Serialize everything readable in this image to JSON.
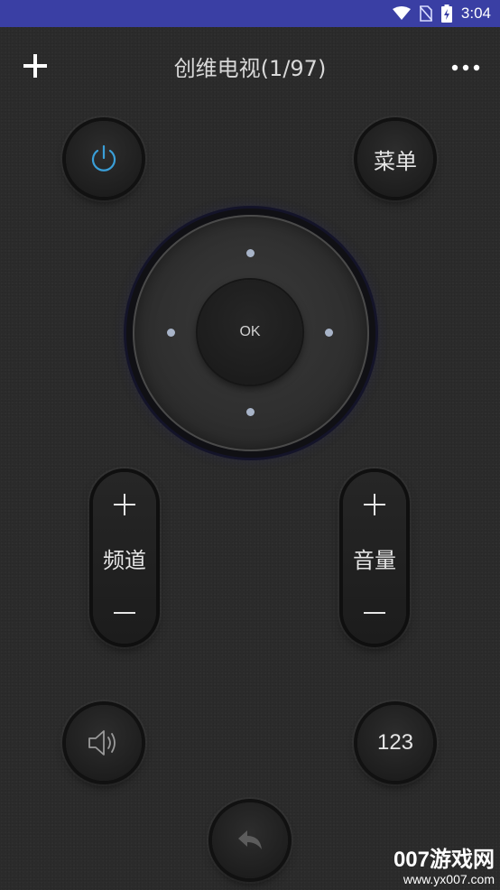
{
  "status_bar": {
    "time": "3:04",
    "bg_color": "#3a3fa4",
    "icons": [
      "wifi-icon",
      "no-sim-icon",
      "battery-charging-icon"
    ]
  },
  "top_bar": {
    "title": "创维电视(1/97)",
    "left_icon": "plus-icon",
    "right_icon": "more-icon"
  },
  "remote": {
    "power_icon": "power-icon",
    "power_color": "#3a9fd8",
    "menu_label": "菜单",
    "ok_label": "OK",
    "channel": {
      "label": "频道",
      "up_icon": "plus-icon",
      "down_icon": "minus-icon"
    },
    "volume": {
      "label": "音量",
      "up_icon": "plus-icon",
      "down_icon": "minus-icon"
    },
    "mute_icon": "speaker-icon",
    "numpad_label": "123",
    "back_icon": "back-arrow-icon"
  },
  "watermark": {
    "brand": "007游戏网",
    "url": "www.yx007.com"
  }
}
